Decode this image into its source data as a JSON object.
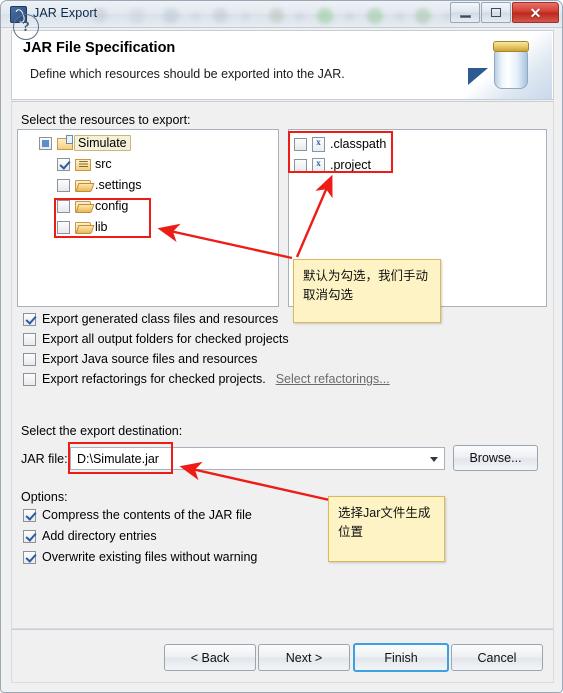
{
  "window": {
    "title": "JAR Export",
    "app_icon": "jar-export-icon",
    "controls": {
      "minimize": "minimize-icon",
      "maximize": "maximize-icon",
      "close": "✕"
    }
  },
  "header": {
    "title": "JAR File Specification",
    "description": "Define which resources should be exported into the JAR.",
    "art_icon": "jar-illustration"
  },
  "main": {
    "resources_label": "Select the resources to export:",
    "tree": [
      {
        "label": "Simulate",
        "state": "grayed",
        "icon": "project-folder-icon",
        "indent": 0,
        "selected": true
      },
      {
        "label": "src",
        "state": "checked",
        "icon": "package-folder-icon",
        "indent": 1,
        "selected": false
      },
      {
        "label": ".settings",
        "state": "unchecked",
        "icon": "folder-icon",
        "indent": 1,
        "selected": false
      },
      {
        "label": "config",
        "state": "unchecked",
        "icon": "folder-icon",
        "indent": 1,
        "selected": false
      },
      {
        "label": "lib",
        "state": "unchecked",
        "icon": "folder-icon",
        "indent": 1,
        "selected": false
      }
    ],
    "files": [
      {
        "label": ".classpath",
        "state": "unchecked",
        "icon": "xml-file-icon"
      },
      {
        "label": ".project",
        "state": "unchecked",
        "icon": "xml-file-icon"
      }
    ],
    "options": [
      {
        "label": "Export generated class files and resources",
        "state": "checked"
      },
      {
        "label": "Export all output folders for checked projects",
        "state": "unchecked"
      },
      {
        "label": "Export Java source files and resources",
        "state": "unchecked"
      },
      {
        "label": "Export refactorings for checked projects.",
        "state": "unchecked",
        "link": "Select refactorings..."
      }
    ]
  },
  "destination": {
    "label": "Select the export destination:",
    "jar_file_label": "JAR file:",
    "jar_file_value": "D:\\Simulate.jar",
    "browse_label": "Browse...",
    "dropdown_icon": "chevron-down-icon"
  },
  "options_section": {
    "label": "Options:",
    "items": [
      {
        "label": "Compress the contents of the JAR file",
        "state": "checked"
      },
      {
        "label": "Add directory entries",
        "state": "checked"
      },
      {
        "label": "Overwrite existing files without warning",
        "state": "checked"
      }
    ]
  },
  "annotations": {
    "tip1": "默认为勾选，我们手动取消勾选",
    "tip2": "选择Jar文件生成位置",
    "accent_color": "#ee1c17",
    "tip_bg": "#fdf3c4"
  },
  "footer": {
    "help_label": "?",
    "back_label": "< Back",
    "next_label": "Next >",
    "finish_label": "Finish",
    "cancel_label": "Cancel"
  }
}
